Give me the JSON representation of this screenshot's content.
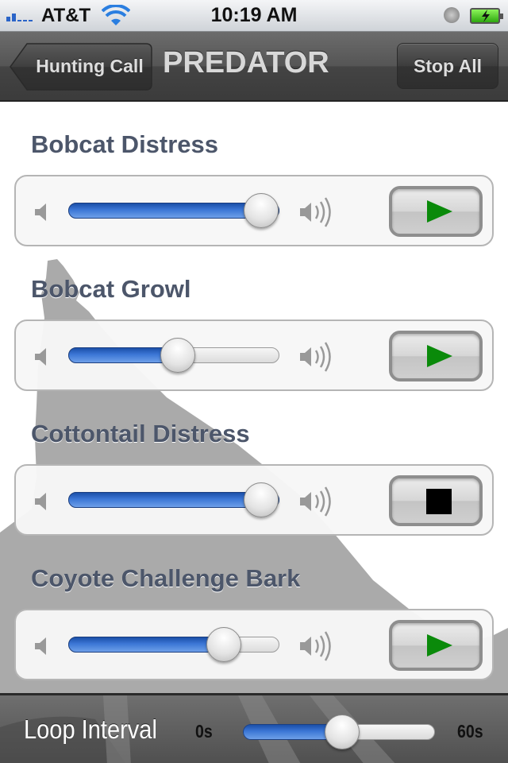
{
  "status_bar": {
    "carrier": "AT&T",
    "time": "10:19 AM",
    "signal_icon": "signal-bars-icon",
    "wifi_icon": "wifi-icon",
    "alarm_icon": "clock-icon",
    "battery_icon": "battery-charging-icon"
  },
  "nav": {
    "back_label": "Hunting Call",
    "title": "PREDATOR",
    "stop_all_label": "Stop All"
  },
  "sounds": [
    {
      "name": "Bobcat Distress",
      "volume": 1.0,
      "state": "stopped",
      "button_icon": "play-icon"
    },
    {
      "name": "Bobcat Growl",
      "volume": 0.52,
      "state": "stopped",
      "button_icon": "play-icon"
    },
    {
      "name": "Cottontail Distress",
      "volume": 1.0,
      "state": "playing",
      "button_icon": "stop-icon"
    },
    {
      "name": "Coyote Challenge Bark",
      "volume": 0.74,
      "state": "stopped",
      "button_icon": "play-icon"
    }
  ],
  "loop": {
    "label": "Loop Interval",
    "min_label": "0s",
    "max_label": "60s",
    "min": 0,
    "max": 60,
    "value": 31
  },
  "colors": {
    "title_text": "#4c566a",
    "slider_fill": "#3c77d6",
    "play_green": "#0a8a0a"
  }
}
